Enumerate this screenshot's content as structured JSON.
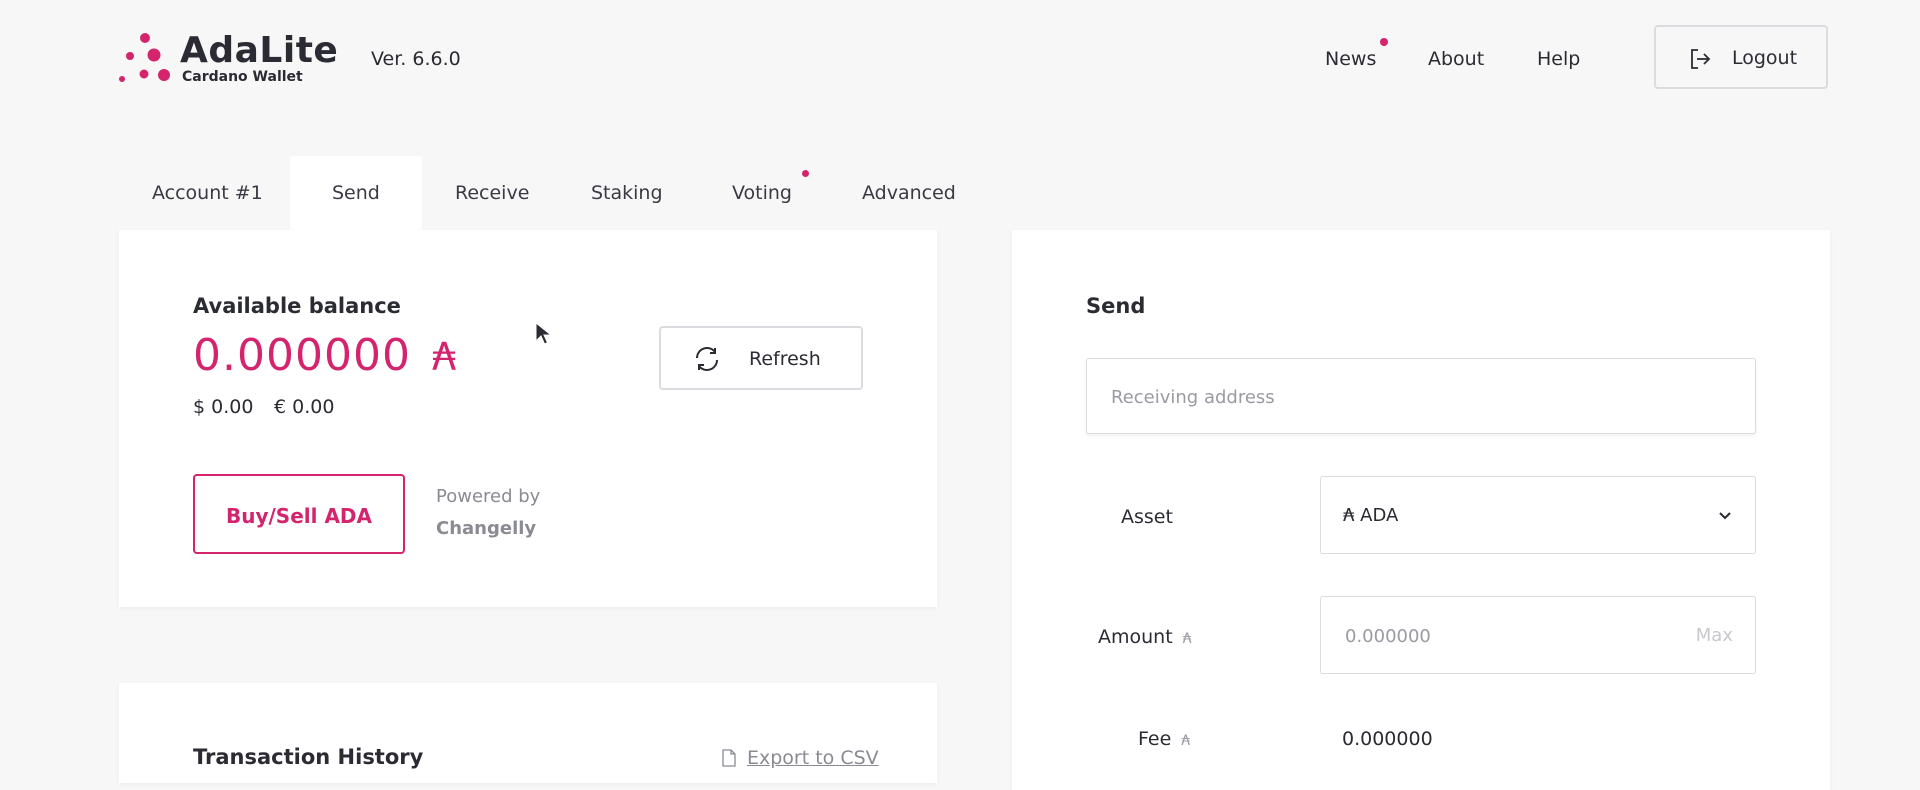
{
  "header": {
    "logo_title": "AdaLite",
    "logo_subtitle": "Cardano Wallet",
    "version": "Ver. 6.6.0",
    "nav": {
      "news": "News",
      "about": "About",
      "help": "Help"
    },
    "logout_label": "Logout"
  },
  "tabs": [
    {
      "label": "Account #1",
      "active": false
    },
    {
      "label": "Send",
      "active": true
    },
    {
      "label": "Receive",
      "active": false
    },
    {
      "label": "Staking",
      "active": false
    },
    {
      "label": "Voting",
      "active": false,
      "notification": true
    },
    {
      "label": "Advanced",
      "active": false
    }
  ],
  "balance": {
    "heading": "Available balance",
    "value": "0.000000",
    "ada_symbol": "₳",
    "usd": "$ 0.00",
    "eur": "€ 0.00",
    "refresh_label": "Refresh",
    "buy_sell_label": "Buy/Sell ADA",
    "powered_by": "Powered by",
    "partner": "Changelly"
  },
  "history": {
    "heading": "Transaction History",
    "export_label": "Export to CSV"
  },
  "send": {
    "heading": "Send",
    "address_placeholder": "Receiving address",
    "asset_label": "Asset",
    "asset_value": "₳  ADA",
    "amount_label": "Amount",
    "amount_placeholder": "0.000000",
    "max_label": "Max",
    "fee_label": "Fee",
    "fee_value": "0.000000",
    "ada_symbol": "₳"
  },
  "colors": {
    "accent": "#d4246d",
    "background": "#f7f7f8",
    "card": "#ffffff",
    "text": "#2b2b33",
    "muted": "#8a8a93"
  },
  "icons": [
    "logo-dots-icon",
    "logout-icon",
    "refresh-icon",
    "csv-icon",
    "chevron-down-icon",
    "mouse-cursor-icon"
  ]
}
